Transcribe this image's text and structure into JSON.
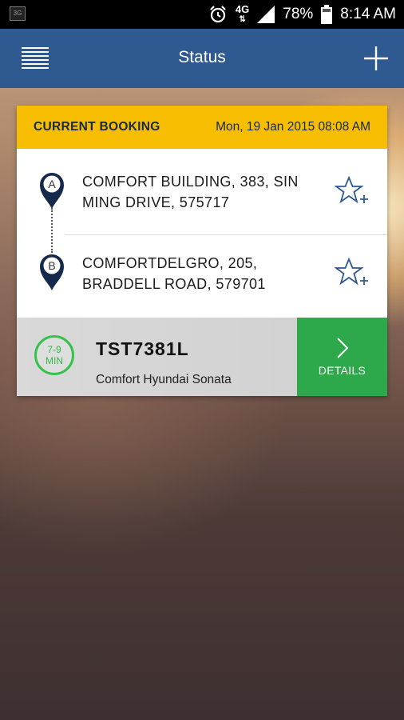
{
  "status_bar": {
    "network_type": "4G",
    "battery": "78%",
    "time": "8:14 AM",
    "left_badge": "3G"
  },
  "app_bar": {
    "title": "Status",
    "menu_icon": "hamburger-menu-icon",
    "add_icon": "plus-icon",
    "color": "#2f5a91"
  },
  "booking": {
    "header_label": "CURRENT BOOKING",
    "datetime": "Mon, 19 Jan 2015 08:08 AM",
    "header_color": "#f7bd00",
    "pickup": {
      "marker": "A",
      "address": "COMFORT BUILDING, 383, SIN MING DRIVE, 575717"
    },
    "dropoff": {
      "marker": "B",
      "address": "COMFORTDELGRO, 205, BRADDELL ROAD, 579701"
    },
    "eta": {
      "range": "7-9",
      "unit": "MIN"
    },
    "vehicle": {
      "plate": "TST7381L",
      "model": "Comfort Hyundai Sonata"
    },
    "details_label": "DETAILS",
    "details_color": "#2da84a"
  }
}
